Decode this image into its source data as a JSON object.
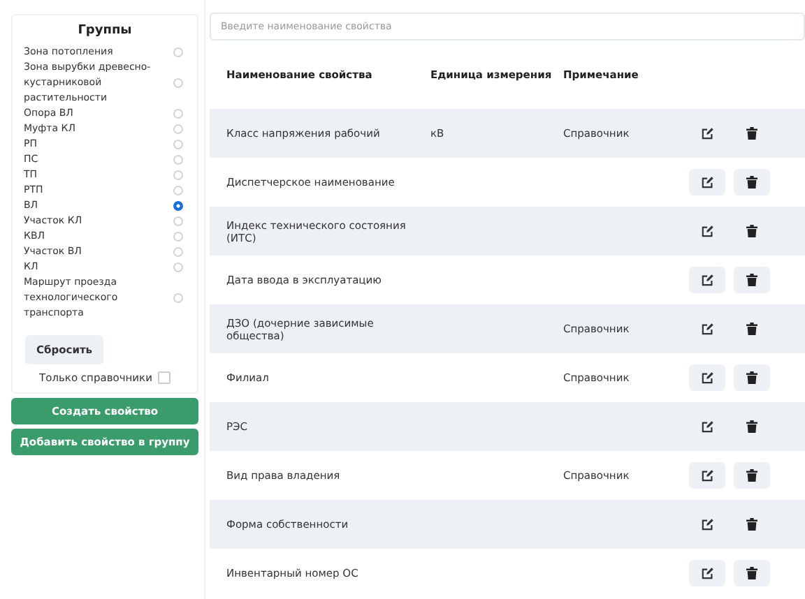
{
  "groups": {
    "title": "Группы",
    "items": [
      {
        "label": "Зона потопления",
        "selected": false
      },
      {
        "label": "Зона вырубки древесно-кустарниковой растительности",
        "selected": false
      },
      {
        "label": "Опора ВЛ",
        "selected": false
      },
      {
        "label": "Муфта КЛ",
        "selected": false
      },
      {
        "label": "РП",
        "selected": false
      },
      {
        "label": "ПС",
        "selected": false
      },
      {
        "label": "ТП",
        "selected": false
      },
      {
        "label": "РТП",
        "selected": false
      },
      {
        "label": "ВЛ",
        "selected": true
      },
      {
        "label": "Участок КЛ",
        "selected": false
      },
      {
        "label": "КВЛ",
        "selected": false
      },
      {
        "label": "Участок ВЛ",
        "selected": false
      },
      {
        "label": "КЛ",
        "selected": false
      },
      {
        "label": "Маршрут проезда технологического транспорта",
        "selected": false
      }
    ],
    "reset_button": "Сбросить",
    "only_refs": {
      "label": "Только справочники",
      "checked": false
    }
  },
  "actions": [
    "Создать свойство",
    "Добавить свойство в группу"
  ],
  "search": {
    "placeholder": "Введите наименование свойства"
  },
  "table": {
    "columns": [
      "Наименование свойства",
      "Единица измерения",
      "Примечание"
    ],
    "rows": [
      {
        "name": "Класс напряжения рабочий",
        "unit": "кВ",
        "note": "Справочник"
      },
      {
        "name": "Диспетчерское наименование",
        "unit": "",
        "note": ""
      },
      {
        "name": "Индекс технического состояния (ИТС)",
        "unit": "",
        "note": ""
      },
      {
        "name": "Дата ввода в эксплуатацию",
        "unit": "",
        "note": ""
      },
      {
        "name": "ДЗО (дочерние зависимые общества)",
        "unit": "",
        "note": "Справочник"
      },
      {
        "name": "Филиал",
        "unit": "",
        "note": "Справочник"
      },
      {
        "name": "РЭС",
        "unit": "",
        "note": ""
      },
      {
        "name": "Вид права владения",
        "unit": "",
        "note": "Справочник"
      },
      {
        "name": "Форма собственности",
        "unit": "",
        "note": ""
      },
      {
        "name": "Инвентарный номер ОС",
        "unit": "",
        "note": ""
      }
    ]
  }
}
